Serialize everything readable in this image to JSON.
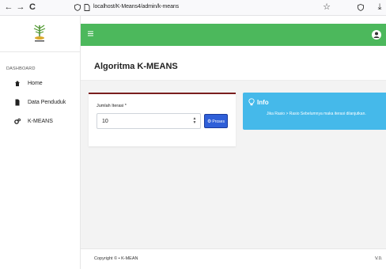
{
  "browser": {
    "url": "localhost/K-Means4/admin/k-means",
    "back": "←",
    "forward": "→",
    "reload": "C",
    "star": "☆",
    "download": "⤓"
  },
  "sidebar": {
    "heading": "DASHBOARD",
    "items": [
      {
        "label": "Home",
        "icon": "home-icon"
      },
      {
        "label": "Data Penduduk",
        "icon": "document-icon"
      },
      {
        "label": "K-MEANS",
        "icon": "gears-icon"
      }
    ]
  },
  "topbar": {
    "menu_icon": "≡"
  },
  "page": {
    "title": "Algoritma K-MEANS"
  },
  "form": {
    "label": "Jumlah Iterasi *",
    "value": "10",
    "button_label": "Proses",
    "button_icon": "⚙"
  },
  "info": {
    "title": "Info",
    "text": "Jika Rasio > Rasio Sebelumnya maka iterasi dilanjutkan."
  },
  "footer": {
    "copyright": "Copyright © • K-MEAN",
    "version": "V.0."
  },
  "colors": {
    "topbar": "#4cb85c",
    "info": "#45b9ea",
    "button": "#2f5fd8",
    "card_border": "#7a1e1e"
  }
}
